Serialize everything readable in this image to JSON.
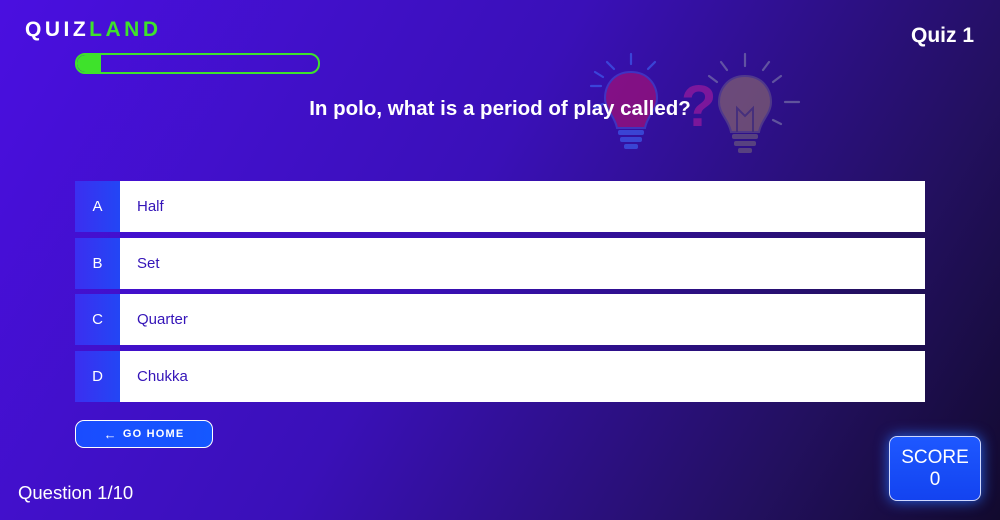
{
  "header": {
    "logo_part1": "QUIZ",
    "logo_part2": "LAND",
    "quiz_title": "Quiz 1"
  },
  "progress": {
    "fraction": 0.1
  },
  "question": {
    "text": "In polo, what is a period of play called?"
  },
  "answers": [
    {
      "letter": "A",
      "text": "Half"
    },
    {
      "letter": "B",
      "text": "Set"
    },
    {
      "letter": "C",
      "text": "Quarter"
    },
    {
      "letter": "D",
      "text": "Chukka"
    }
  ],
  "go_home": {
    "label": "GO HOME",
    "icon": "arrow-left-icon"
  },
  "footer": {
    "question_counter": "Question 1/10"
  },
  "score": {
    "label": "SCORE",
    "value": "0"
  },
  "colors": {
    "accent_green": "#3ee22b",
    "button_blue": "#1a4cff",
    "answer_text": "#3414b8"
  }
}
